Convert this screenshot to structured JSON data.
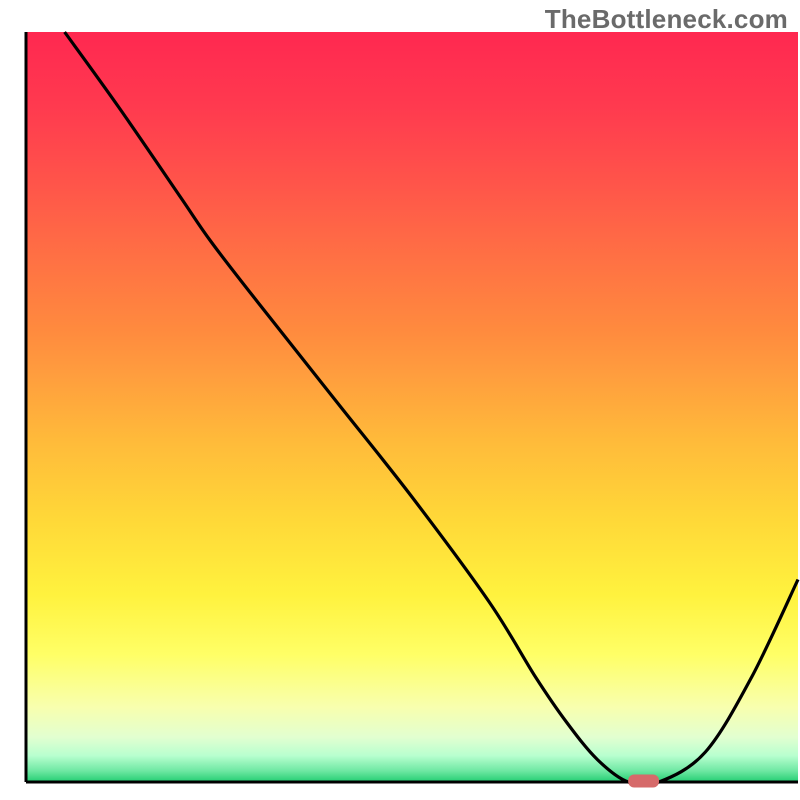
{
  "watermark": "TheBottleneck.com",
  "chart_data": {
    "type": "line",
    "title": "",
    "xlabel": "",
    "ylabel": "",
    "xlim": [
      0,
      100
    ],
    "ylim": [
      0,
      100
    ],
    "series": [
      {
        "name": "bottleneck-curve",
        "x": [
          5,
          12,
          20,
          24,
          30,
          40,
          50,
          60,
          66,
          70,
          74,
          78,
          82,
          88,
          94,
          100
        ],
        "values": [
          100,
          90,
          78,
          72,
          64,
          51,
          38,
          24,
          14,
          8,
          3,
          0,
          0,
          4,
          14,
          27
        ]
      }
    ],
    "marker": {
      "name": "optimal-range",
      "x_start": 78,
      "x_end": 82,
      "y": 0
    },
    "background_gradient": {
      "stops": [
        {
          "offset": 0.0,
          "color": "#ff2850"
        },
        {
          "offset": 0.1,
          "color": "#ff3a4f"
        },
        {
          "offset": 0.2,
          "color": "#ff544a"
        },
        {
          "offset": 0.3,
          "color": "#ff7044"
        },
        {
          "offset": 0.4,
          "color": "#ff8b3e"
        },
        {
          "offset": 0.45,
          "color": "#ff9b3e"
        },
        {
          "offset": 0.55,
          "color": "#ffbc3a"
        },
        {
          "offset": 0.65,
          "color": "#ffd838"
        },
        {
          "offset": 0.75,
          "color": "#fff23e"
        },
        {
          "offset": 0.83,
          "color": "#ffff66"
        },
        {
          "offset": 0.9,
          "color": "#f8ffae"
        },
        {
          "offset": 0.94,
          "color": "#e2ffd0"
        },
        {
          "offset": 0.965,
          "color": "#b8ffcf"
        },
        {
          "offset": 0.985,
          "color": "#6fe8a3"
        },
        {
          "offset": 1.0,
          "color": "#22cd72"
        }
      ]
    }
  }
}
